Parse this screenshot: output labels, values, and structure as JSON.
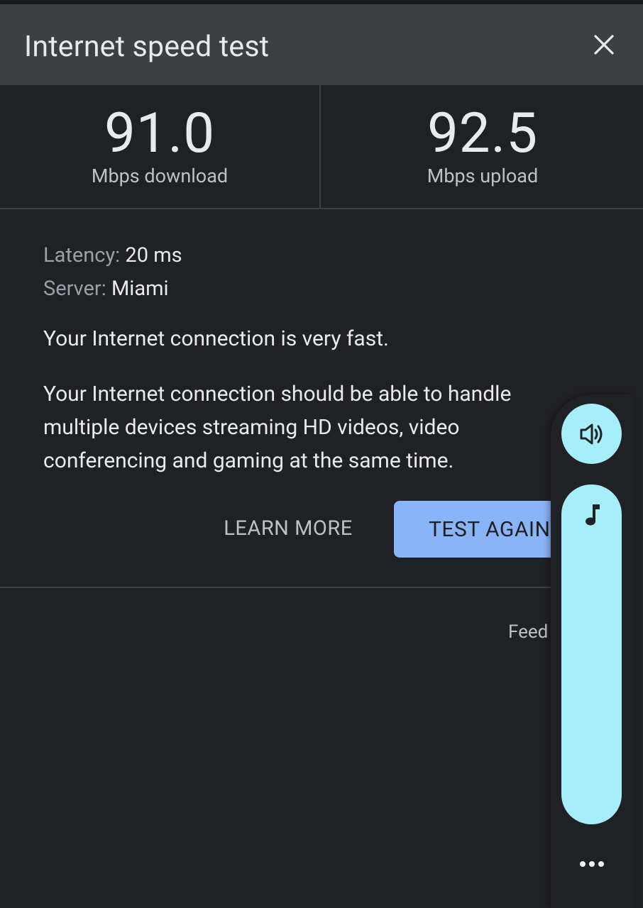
{
  "header": {
    "title": "Internet speed test"
  },
  "metrics": {
    "download": {
      "value": "91.0",
      "unit": "Mbps download"
    },
    "upload": {
      "value": "92.5",
      "unit": "Mbps upload"
    }
  },
  "details": {
    "latency_label": "Latency:",
    "latency_value": "20 ms",
    "server_label": "Server:",
    "server_value": "Miami"
  },
  "verdict": "Your Internet connection is very fast.",
  "description": "Your Internet connection should be able to handle multiple devices streaming HD videos, video conferencing and gaming at the same time.",
  "actions": {
    "learn_more": "LEARN MORE",
    "test_again": "TEST AGAIN"
  },
  "footer": {
    "feedback": "Feed"
  },
  "volume_panel": {
    "accent_color": "#a6eefa",
    "icons": [
      "speaker-icon",
      "music-note-icon",
      "more-horiz-icon"
    ],
    "level": 1.0
  },
  "colors": {
    "background": "#202124",
    "header": "#3c4043",
    "primary_button": "#8ab4f8"
  }
}
